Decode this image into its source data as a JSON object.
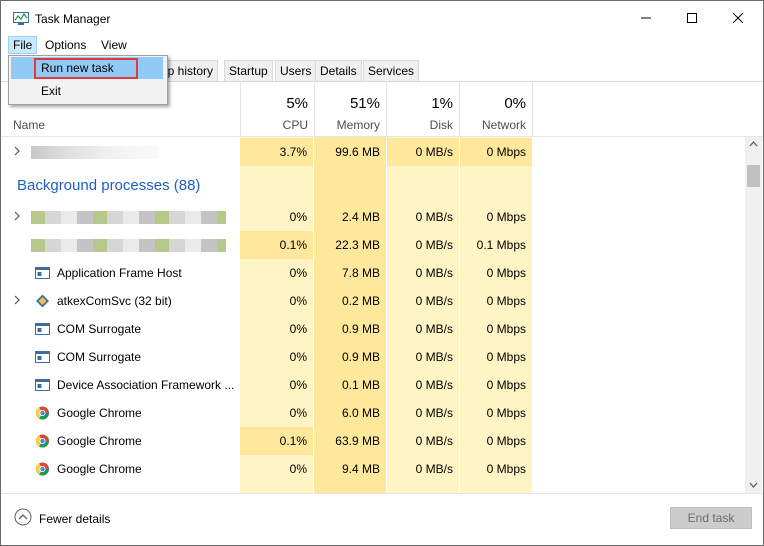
{
  "window": {
    "title": "Task Manager"
  },
  "menu": {
    "file": "File",
    "options": "Options",
    "view": "View"
  },
  "file_menu": {
    "items": [
      "Run new task",
      "Exit"
    ]
  },
  "tabs": [
    "pp history",
    "Startup",
    "Users",
    "Details",
    "Services"
  ],
  "columns": {
    "name": "Name",
    "cpu": {
      "pct": "5%",
      "label": "CPU"
    },
    "memory": {
      "pct": "51%",
      "label": "Memory"
    },
    "disk": {
      "pct": "1%",
      "label": "Disk"
    },
    "network": {
      "pct": "0%",
      "label": "Network"
    }
  },
  "app_row": {
    "cpu": "3.7%",
    "memory": "99.6 MB",
    "disk": "0 MB/s",
    "network": "0 Mbps"
  },
  "group": {
    "title": "Background processes (88)"
  },
  "processes": [
    {
      "name": "",
      "cpu": "0%",
      "memory": "2.4 MB",
      "disk": "0 MB/s",
      "network": "0 Mbps"
    },
    {
      "name": "",
      "cpu": "0.1%",
      "memory": "22.3 MB",
      "disk": "0 MB/s",
      "network": "0.1 Mbps"
    },
    {
      "name": "Application Frame Host",
      "cpu": "0%",
      "memory": "7.8 MB",
      "disk": "0 MB/s",
      "network": "0 Mbps"
    },
    {
      "name": "atkexComSvc (32 bit)",
      "cpu": "0%",
      "memory": "0.2 MB",
      "disk": "0 MB/s",
      "network": "0 Mbps"
    },
    {
      "name": "COM Surrogate",
      "cpu": "0%",
      "memory": "0.9 MB",
      "disk": "0 MB/s",
      "network": "0 Mbps"
    },
    {
      "name": "COM Surrogate",
      "cpu": "0%",
      "memory": "0.9 MB",
      "disk": "0 MB/s",
      "network": "0 Mbps"
    },
    {
      "name": "Device Association Framework ...",
      "cpu": "0%",
      "memory": "0.1 MB",
      "disk": "0 MB/s",
      "network": "0 Mbps"
    },
    {
      "name": "Google Chrome",
      "cpu": "0%",
      "memory": "6.0 MB",
      "disk": "0 MB/s",
      "network": "0 Mbps"
    },
    {
      "name": "Google Chrome",
      "cpu": "0.1%",
      "memory": "63.9 MB",
      "disk": "0 MB/s",
      "network": "0 Mbps"
    },
    {
      "name": "Google Chrome",
      "cpu": "0%",
      "memory": "9.4 MB",
      "disk": "0 MB/s",
      "network": "0 Mbps"
    }
  ],
  "footer": {
    "fewer_details": "Fewer details",
    "end_task": "End task"
  },
  "colors": {
    "accent_blue": "#1f5fbf",
    "heat_light": "#fff4c4",
    "heat_dark": "#ffe89c",
    "highlight_red": "#e23b3b",
    "menu_highlight": "#91c9f7"
  }
}
